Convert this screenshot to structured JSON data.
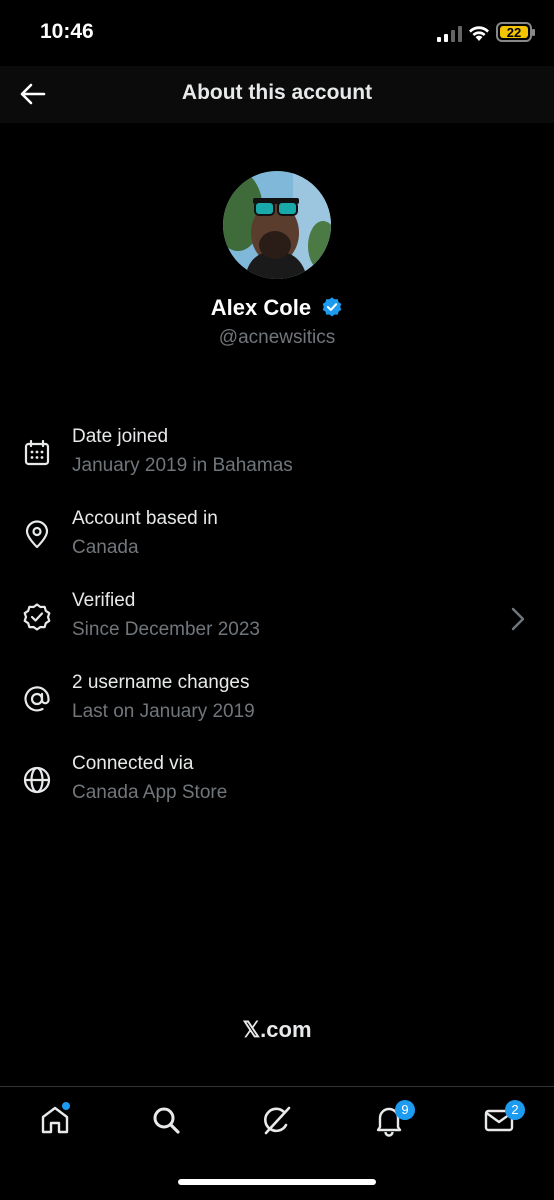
{
  "status_bar": {
    "time": "10:46",
    "battery": "22"
  },
  "header": {
    "title": "About this account"
  },
  "profile": {
    "name": "Alex Cole",
    "handle": "@acnewsitics"
  },
  "rows": [
    {
      "label": "Date joined",
      "sub": "January 2019 in Bahamas",
      "icon": "calendar-icon"
    },
    {
      "label": "Account based in",
      "sub": "Canada",
      "icon": "location-pin-icon"
    },
    {
      "label": "Verified",
      "sub": "Since December 2023",
      "icon": "verified-badge-icon"
    },
    {
      "label": "2 username changes",
      "sub": "Last on January 2019",
      "icon": "at-sign-icon"
    },
    {
      "label": "Connected via",
      "sub": "Canada App Store",
      "icon": "globe-icon"
    }
  ],
  "footer": {
    "logo": "𝕏.com"
  },
  "tabbar": {
    "notifications_badge": "9",
    "messages_badge": "2"
  },
  "colors": {
    "accent": "#1d9bf0",
    "muted": "#71767b",
    "battery": "#f5c400"
  }
}
